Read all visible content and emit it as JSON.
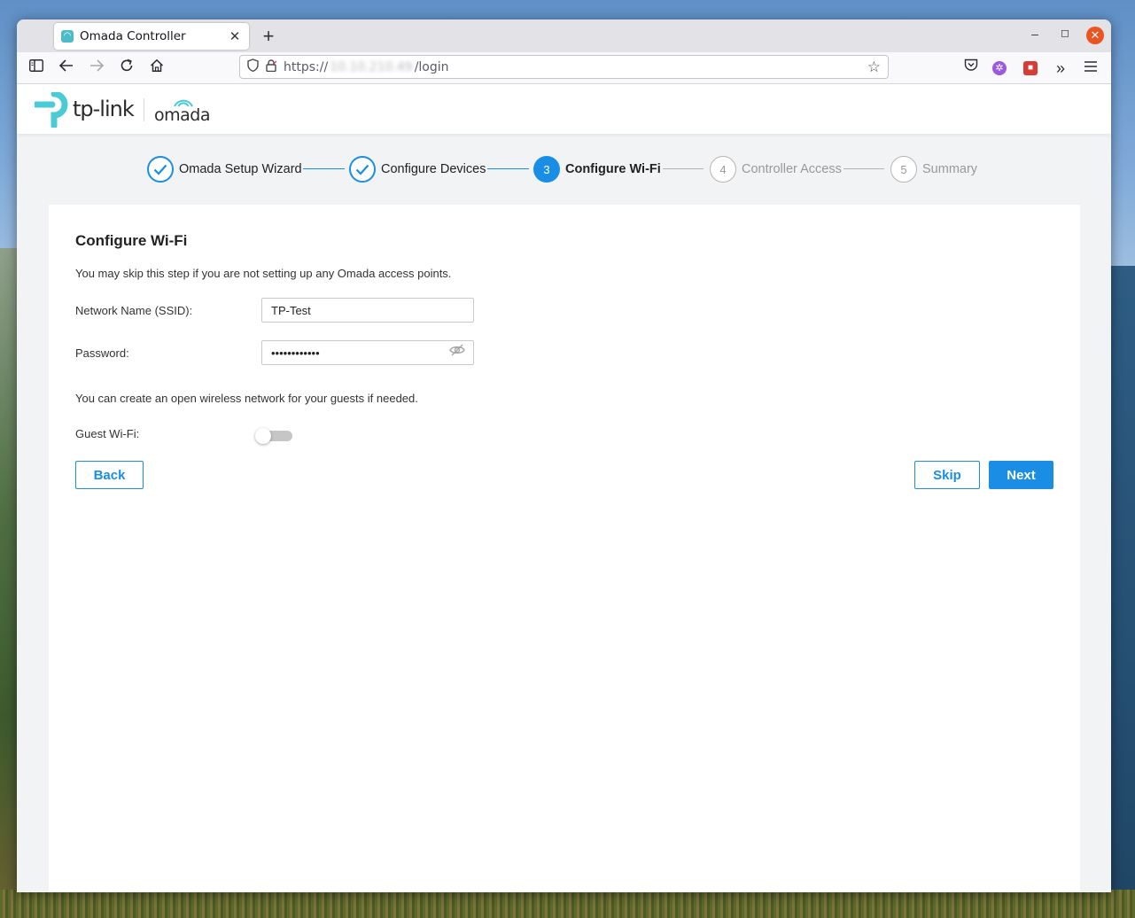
{
  "browser": {
    "tab_title": "Omada Controller",
    "tab_close": "✕",
    "new_tab": "+",
    "url_scheme": "https://",
    "url_host": "10.10.210.49",
    "url_path": "/login",
    "window_controls": {
      "minimize": "–",
      "maximize": "◻",
      "close": "✕"
    }
  },
  "header": {
    "brand": "tp-link",
    "product": "omada",
    "brand_color": "#4acbd6"
  },
  "stepper": {
    "steps": [
      {
        "number": "",
        "label": "Omada Setup Wizard",
        "state": "done"
      },
      {
        "number": "",
        "label": "Configure Devices",
        "state": "done"
      },
      {
        "number": "3",
        "label": "Configure Wi-Fi",
        "state": "active"
      },
      {
        "number": "4",
        "label": "Controller Access",
        "state": "todo"
      },
      {
        "number": "5",
        "label": "Summary",
        "state": "todo"
      }
    ],
    "accent_color": "#1a8ee4"
  },
  "form": {
    "title": "Configure Wi-Fi",
    "description": "You may skip this step if you are not setting up any Omada access points.",
    "ssid_label": "Network Name (SSID):",
    "ssid_value": "TP-Test",
    "password_label": "Password:",
    "password_value": "••••••••••••",
    "guest_note": "You can create an open wireless network for your guests if needed.",
    "guest_label": "Guest Wi-Fi:",
    "guest_enabled": false
  },
  "buttons": {
    "back": "Back",
    "skip": "Skip",
    "next": "Next"
  }
}
